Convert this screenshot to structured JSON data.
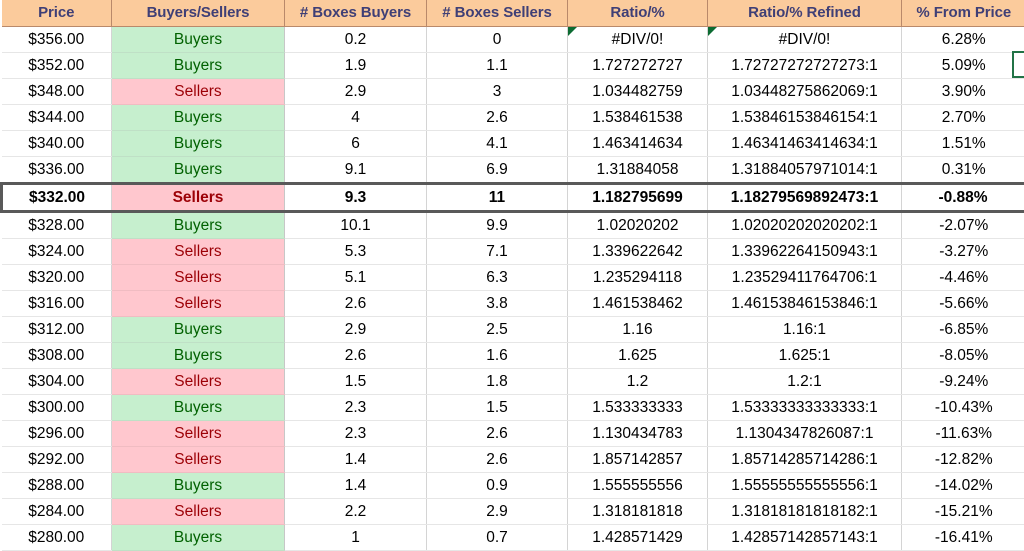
{
  "table": {
    "columns": [
      {
        "key": "price",
        "label": "Price"
      },
      {
        "key": "side",
        "label": "Buyers/Sellers"
      },
      {
        "key": "boxes_buyers",
        "label": "# Boxes Buyers"
      },
      {
        "key": "boxes_sellers",
        "label": "# Boxes Sellers"
      },
      {
        "key": "ratio",
        "label": "Ratio/%"
      },
      {
        "key": "ratio_refined",
        "label": "Ratio/% Refined"
      },
      {
        "key": "pct_from_price",
        "label": "% From Price"
      }
    ],
    "colors": {
      "header_bg": "#FBCB9C",
      "header_text": "#3F3F76",
      "buyers_bg": "#C6EFCE",
      "buyers_text": "#006100",
      "sellers_bg": "#FFC7CE",
      "sellers_text": "#9C0006",
      "selection_border": "#595959",
      "cell_selection": "#217346",
      "error_marker": "#0C6B32"
    },
    "rows": [
      {
        "price": "$356.00",
        "side": "Buyers",
        "boxes_buyers": "0.2",
        "boxes_sellers": "0",
        "ratio": "#DIV/0!",
        "ratio_refined": "#DIV/0!",
        "pct_from_price": "6.28%",
        "error": true,
        "selected": false
      },
      {
        "price": "$352.00",
        "side": "Buyers",
        "boxes_buyers": "1.9",
        "boxes_sellers": "1.1",
        "ratio": "1.727272727",
        "ratio_refined": "1.72727272727273:1",
        "pct_from_price": "5.09%",
        "error": false,
        "selected": false
      },
      {
        "price": "$348.00",
        "side": "Sellers",
        "boxes_buyers": "2.9",
        "boxes_sellers": "3",
        "ratio": "1.034482759",
        "ratio_refined": "1.03448275862069:1",
        "pct_from_price": "3.90%",
        "error": false,
        "selected": false
      },
      {
        "price": "$344.00",
        "side": "Buyers",
        "boxes_buyers": "4",
        "boxes_sellers": "2.6",
        "ratio": "1.538461538",
        "ratio_refined": "1.53846153846154:1",
        "pct_from_price": "2.70%",
        "error": false,
        "selected": false
      },
      {
        "price": "$340.00",
        "side": "Buyers",
        "boxes_buyers": "6",
        "boxes_sellers": "4.1",
        "ratio": "1.463414634",
        "ratio_refined": "1.46341463414634:1",
        "pct_from_price": "1.51%",
        "error": false,
        "selected": false
      },
      {
        "price": "$336.00",
        "side": "Buyers",
        "boxes_buyers": "9.1",
        "boxes_sellers": "6.9",
        "ratio": "1.31884058",
        "ratio_refined": "1.31884057971014:1",
        "pct_from_price": "0.31%",
        "error": false,
        "selected": false
      },
      {
        "price": "$332.00",
        "side": "Sellers",
        "boxes_buyers": "9.3",
        "boxes_sellers": "11",
        "ratio": "1.182795699",
        "ratio_refined": "1.18279569892473:1",
        "pct_from_price": "-0.88%",
        "error": false,
        "selected": true
      },
      {
        "price": "$328.00",
        "side": "Buyers",
        "boxes_buyers": "10.1",
        "boxes_sellers": "9.9",
        "ratio": "1.02020202",
        "ratio_refined": "1.02020202020202:1",
        "pct_from_price": "-2.07%",
        "error": false,
        "selected": false
      },
      {
        "price": "$324.00",
        "side": "Sellers",
        "boxes_buyers": "5.3",
        "boxes_sellers": "7.1",
        "ratio": "1.339622642",
        "ratio_refined": "1.33962264150943:1",
        "pct_from_price": "-3.27%",
        "error": false,
        "selected": false
      },
      {
        "price": "$320.00",
        "side": "Sellers",
        "boxes_buyers": "5.1",
        "boxes_sellers": "6.3",
        "ratio": "1.235294118",
        "ratio_refined": "1.23529411764706:1",
        "pct_from_price": "-4.46%",
        "error": false,
        "selected": false
      },
      {
        "price": "$316.00",
        "side": "Sellers",
        "boxes_buyers": "2.6",
        "boxes_sellers": "3.8",
        "ratio": "1.461538462",
        "ratio_refined": "1.46153846153846:1",
        "pct_from_price": "-5.66%",
        "error": false,
        "selected": false
      },
      {
        "price": "$312.00",
        "side": "Buyers",
        "boxes_buyers": "2.9",
        "boxes_sellers": "2.5",
        "ratio": "1.16",
        "ratio_refined": "1.16:1",
        "pct_from_price": "-6.85%",
        "error": false,
        "selected": false
      },
      {
        "price": "$308.00",
        "side": "Buyers",
        "boxes_buyers": "2.6",
        "boxes_sellers": "1.6",
        "ratio": "1.625",
        "ratio_refined": "1.625:1",
        "pct_from_price": "-8.05%",
        "error": false,
        "selected": false
      },
      {
        "price": "$304.00",
        "side": "Sellers",
        "boxes_buyers": "1.5",
        "boxes_sellers": "1.8",
        "ratio": "1.2",
        "ratio_refined": "1.2:1",
        "pct_from_price": "-9.24%",
        "error": false,
        "selected": false
      },
      {
        "price": "$300.00",
        "side": "Buyers",
        "boxes_buyers": "2.3",
        "boxes_sellers": "1.5",
        "ratio": "1.533333333",
        "ratio_refined": "1.53333333333333:1",
        "pct_from_price": "-10.43%",
        "error": false,
        "selected": false
      },
      {
        "price": "$296.00",
        "side": "Sellers",
        "boxes_buyers": "2.3",
        "boxes_sellers": "2.6",
        "ratio": "1.130434783",
        "ratio_refined": "1.1304347826087:1",
        "pct_from_price": "-11.63%",
        "error": false,
        "selected": false
      },
      {
        "price": "$292.00",
        "side": "Sellers",
        "boxes_buyers": "1.4",
        "boxes_sellers": "2.6",
        "ratio": "1.857142857",
        "ratio_refined": "1.85714285714286:1",
        "pct_from_price": "-12.82%",
        "error": false,
        "selected": false
      },
      {
        "price": "$288.00",
        "side": "Buyers",
        "boxes_buyers": "1.4",
        "boxes_sellers": "0.9",
        "ratio": "1.555555556",
        "ratio_refined": "1.55555555555556:1",
        "pct_from_price": "-14.02%",
        "error": false,
        "selected": false
      },
      {
        "price": "$284.00",
        "side": "Sellers",
        "boxes_buyers": "2.2",
        "boxes_sellers": "2.9",
        "ratio": "1.318181818",
        "ratio_refined": "1.31818181818182:1",
        "pct_from_price": "-15.21%",
        "error": false,
        "selected": false
      },
      {
        "price": "$280.00",
        "side": "Buyers",
        "boxes_buyers": "1",
        "boxes_sellers": "0.7",
        "ratio": "1.428571429",
        "ratio_refined": "1.42857142857143:1",
        "pct_from_price": "-16.41%",
        "error": false,
        "selected": false
      }
    ]
  },
  "cell_selection": {
    "row_index": 1,
    "visible_fragment": true
  }
}
